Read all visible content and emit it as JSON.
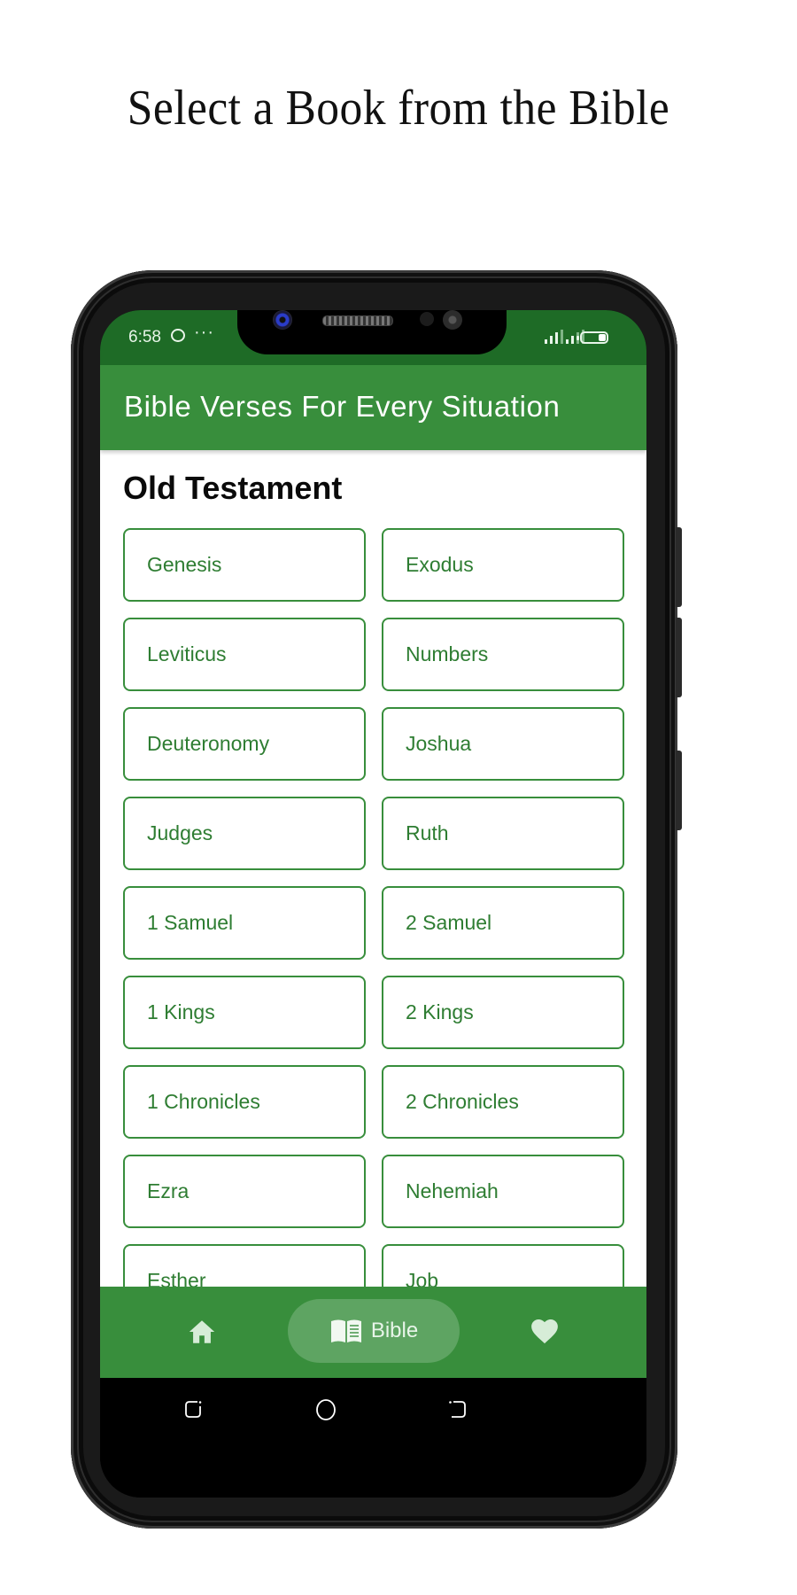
{
  "caption": "Select a Book from the Bible",
  "status_bar": {
    "time": "6:58",
    "icons": [
      "chat-bubble-icon",
      "more-dots-icon",
      "signal-icon",
      "signal-icon",
      "battery-icon"
    ],
    "dots": "···"
  },
  "app_bar": {
    "title": "Bible Verses For Every Situation"
  },
  "section": {
    "title": "Old Testament"
  },
  "books": [
    "Genesis",
    "Exodus",
    "Leviticus",
    "Numbers",
    "Deuteronomy",
    "Joshua",
    "Judges",
    "Ruth",
    "1 Samuel",
    "2 Samuel",
    "1 Kings",
    "2 Kings",
    "1 Chronicles",
    "2 Chronicles",
    "Ezra",
    "Nehemiah",
    "Esther",
    "Job"
  ],
  "bottom_nav": {
    "items": [
      {
        "icon": "home-icon",
        "label": "",
        "active": false
      },
      {
        "icon": "open-book-icon",
        "label": "Bible",
        "active": true
      },
      {
        "icon": "heart-icon",
        "label": "",
        "active": false
      }
    ]
  },
  "system_nav": {
    "icons": [
      "recents-icon",
      "home-circle-icon",
      "back-icon"
    ]
  },
  "colors": {
    "primary": "#388e3c",
    "status_bar": "#1e6b26",
    "button_text": "#2e7d32",
    "nav_pill": "#5ea462"
  }
}
